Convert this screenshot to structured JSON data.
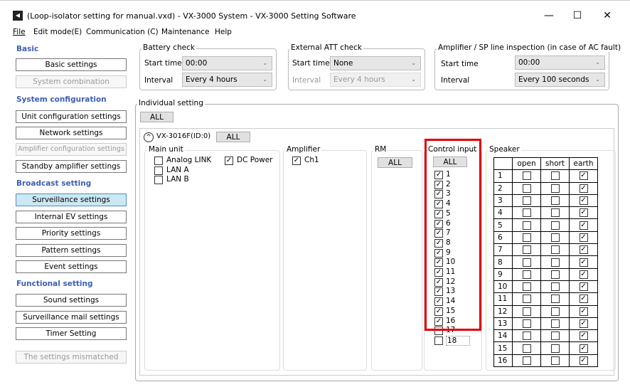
{
  "window": {
    "title": "(Loop-isolator setting for manual.vxd) - VX-3000 System - VX-3000 Setting Software",
    "minimize": "—",
    "maximize": "☐",
    "close": "✕"
  },
  "menu": [
    {
      "label": "File"
    },
    {
      "label": "Edit mode(E)"
    },
    {
      "label": "Communication (C)"
    },
    {
      "label": "Maintenance"
    },
    {
      "label": "Help"
    }
  ],
  "sidebar": {
    "sections": [
      {
        "label": "Basic",
        "items": [
          {
            "label": "Basic settings",
            "state": "normal"
          },
          {
            "label": "System combination",
            "state": "disabled"
          }
        ]
      },
      {
        "label": "System configuration",
        "items": [
          {
            "label": "Unit configuration settings",
            "state": "normal"
          },
          {
            "label": "Network settings",
            "state": "normal"
          },
          {
            "label": "Amplifier configuration settings",
            "state": "disabled"
          },
          {
            "label": "Standby amplifier settings",
            "state": "normal"
          }
        ]
      },
      {
        "label": "Broadcast setting",
        "items": [
          {
            "label": "Surveillance settings",
            "state": "selected"
          },
          {
            "label": "Internal EV settings",
            "state": "normal"
          },
          {
            "label": "Priority settings",
            "state": "normal"
          },
          {
            "label": "Pattern settings",
            "state": "normal"
          },
          {
            "label": "Event settings",
            "state": "normal"
          }
        ]
      },
      {
        "label": "Functional setting",
        "items": [
          {
            "label": "Sound settings",
            "state": "normal"
          },
          {
            "label": "Surveillance mail settings",
            "state": "normal"
          },
          {
            "label": "Timer Setting",
            "state": "normal"
          }
        ]
      }
    ],
    "mismatch": "The settings mismatched"
  },
  "battery": {
    "title": "Battery check",
    "start_label": "Start time",
    "start_value": "00:00",
    "interval_label": "Interval",
    "interval_value": "Every 4 hours"
  },
  "att": {
    "title": "External ATT check",
    "start_label": "Start time",
    "start_value": "None",
    "interval_label": "Interval",
    "interval_value": "Every 4 hours"
  },
  "amp": {
    "title": "Amplifier / SP line inspection (in case of AC fault)",
    "start_label": "Start time",
    "start_value": "00:00",
    "interval_label": "Interval",
    "interval_value": "Every 100 seconds"
  },
  "individual": {
    "title": "Individual setting",
    "all": "ALL",
    "unit": {
      "name": "VX-3016F(ID:0)",
      "all": "ALL",
      "main_unit": {
        "title": "Main unit",
        "items": [
          {
            "label": "Analog LINK",
            "checked": false
          },
          {
            "label": "LAN A",
            "checked": false
          },
          {
            "label": "LAN B",
            "checked": false
          },
          {
            "label": "DC Power",
            "checked": true
          }
        ]
      },
      "amplifier": {
        "title": "Amplifier",
        "items": [
          {
            "label": "Ch1",
            "checked": true
          }
        ]
      },
      "rm": {
        "title": "RM",
        "all": "ALL"
      },
      "control_input": {
        "title": "Control input",
        "all": "ALL",
        "items": [
          {
            "label": "1",
            "checked": true
          },
          {
            "label": "2",
            "checked": true
          },
          {
            "label": "3",
            "checked": true
          },
          {
            "label": "4",
            "checked": true
          },
          {
            "label": "5",
            "checked": true
          },
          {
            "label": "6",
            "checked": true
          },
          {
            "label": "7",
            "checked": true
          },
          {
            "label": "8",
            "checked": true
          },
          {
            "label": "9",
            "checked": true
          },
          {
            "label": "10",
            "checked": true
          },
          {
            "label": "11",
            "checked": true
          },
          {
            "label": "12",
            "checked": true
          },
          {
            "label": "13",
            "checked": true
          },
          {
            "label": "14",
            "checked": true
          },
          {
            "label": "15",
            "checked": true
          },
          {
            "label": "16",
            "checked": true
          },
          {
            "label": "17",
            "checked": false
          },
          {
            "label": "18",
            "checked": false
          }
        ],
        "highlight_color": "#e00000"
      },
      "speaker": {
        "title": "Speaker",
        "columns": [
          "open",
          "short",
          "earth"
        ],
        "rows": [
          {
            "n": "1",
            "open": false,
            "short": false,
            "earth": true
          },
          {
            "n": "2",
            "open": false,
            "short": false,
            "earth": true
          },
          {
            "n": "3",
            "open": false,
            "short": false,
            "earth": true
          },
          {
            "n": "4",
            "open": false,
            "short": false,
            "earth": true
          },
          {
            "n": "5",
            "open": false,
            "short": false,
            "earth": true
          },
          {
            "n": "6",
            "open": false,
            "short": false,
            "earth": true
          },
          {
            "n": "7",
            "open": false,
            "short": false,
            "earth": true
          },
          {
            "n": "8",
            "open": false,
            "short": false,
            "earth": true
          },
          {
            "n": "9",
            "open": false,
            "short": false,
            "earth": true
          },
          {
            "n": "10",
            "open": false,
            "short": false,
            "earth": true
          },
          {
            "n": "11",
            "open": false,
            "short": false,
            "earth": true
          },
          {
            "n": "12",
            "open": false,
            "short": false,
            "earth": true
          },
          {
            "n": "13",
            "open": false,
            "short": false,
            "earth": true
          },
          {
            "n": "14",
            "open": false,
            "short": false,
            "earth": true
          },
          {
            "n": "15",
            "open": false,
            "short": false,
            "earth": true
          },
          {
            "n": "16",
            "open": false,
            "short": false,
            "earth": true
          }
        ]
      }
    }
  }
}
